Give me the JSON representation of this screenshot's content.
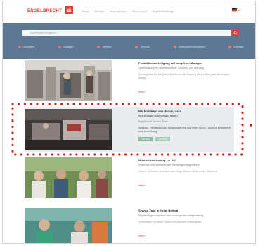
{
  "header": {
    "logo_text": "ENGELBRECHT",
    "menu": [
      "Home",
      "Service",
      "Unternehmen",
      "Referenzen",
      "Angebotsanfrage"
    ],
    "language_icon": "flag-icon"
  },
  "search": {
    "placeholder": "Suchbegriff eingeben...",
    "button_icon": "search-icon"
  },
  "categories": [
    {
      "label": "Aktuelles",
      "icon": "dot-icon"
    },
    {
      "label": "Anlagen",
      "icon": "dot-icon"
    },
    {
      "label": "Service",
      "icon": "dot-icon"
    },
    {
      "label": "Technik",
      "icon": "dot-icon"
    },
    {
      "label": "Gebrauchtmaschinen",
      "icon": "dot-icon"
    },
    {
      "label": "Kontakt",
      "icon": "dot-icon"
    }
  ],
  "articles": [
    {
      "title": "Produktionsbeteiligung auf komplexen Anlagen",
      "subtitle": "Unterstützung bei Inbetriebnahme, Schulung und Wartung",
      "text": "Wir begleiten Sie bei jedem Schritt von der Planung bis zur Übergabe der fertigen Anlage.",
      "more": "mehr »"
    },
    {
      "title": "Mitarbeiterschulung vor Ort",
      "subtitle": "Praxisnah und individuell auf Ihre Anlagen abgestimmt",
      "text": "Unsere Techniker vermitteln das nötige Wissen direkt an der Maschine.",
      "more": "mehr »"
    },
    {
      "title": "Service-Tage in Ihrem Betrieb",
      "subtitle": "Regelmäßige Inspektion und vorbeugende Instandhaltung",
      "text": "Vereinbaren Sie einen Termin mit unserem Serviceteam.",
      "more": "mehr »"
    }
  ],
  "featured": {
    "title": "Wir kümmern uns darum, dass",
    "subtitle": "Ihre Anlagen zuverlässig laufen",
    "meta": "Engelbrecht Service-Team",
    "text": "Wartung, Reparatur und Modernisierung aus einer Hand – schnell, kompetent und zuverlässig.",
    "tags": [
      "Service",
      "Wartung"
    ]
  },
  "colors": {
    "accent": "#d9413a",
    "hero": "#5d7895",
    "highlight_dots": "#c72e26"
  }
}
